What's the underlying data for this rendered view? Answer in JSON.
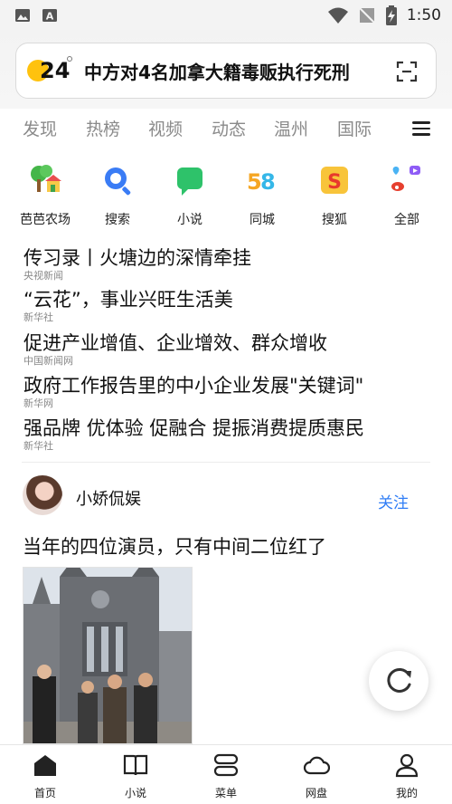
{
  "status_bar": {
    "time": "1:50"
  },
  "search": {
    "temperature": "24",
    "hot_query": "中方对4名加拿大籍毒贩执行死刑"
  },
  "tabs": [
    "发现",
    "热榜",
    "视频",
    "动态",
    "温州",
    "国际"
  ],
  "shortcuts": [
    {
      "label": "芭芭农场",
      "icon": "farm-icon"
    },
    {
      "label": "搜索",
      "icon": "search-icon"
    },
    {
      "label": "小说",
      "icon": "novel-icon"
    },
    {
      "label": "同城",
      "icon": "58-icon"
    },
    {
      "label": "搜狐",
      "icon": "sohu-icon"
    },
    {
      "label": "全部",
      "icon": "all-apps-icon"
    }
  ],
  "news": [
    {
      "title": "传习录丨火塘边的深情牵挂",
      "source": "央视新闻"
    },
    {
      "title": "“云花”，事业兴旺生活美",
      "source": "新华社"
    },
    {
      "title": "促进产业增值、企业增效、群众增收",
      "source": "中国新闻网"
    },
    {
      "title": "政府工作报告里的中小企业发展\"关键词\"",
      "source": "新华网"
    },
    {
      "title": "强品牌 优体验 促融合 提振消费提质惠民",
      "source": "新华社"
    }
  ],
  "feed_card": {
    "author": "小娇侃娱",
    "follow_label": "关注",
    "title": "当年的四位演员，只有中间二位红了"
  },
  "bottom_nav": [
    {
      "label": "首页",
      "icon": "home-icon"
    },
    {
      "label": "小说",
      "icon": "book-icon"
    },
    {
      "label": "菜单",
      "icon": "menu-icon"
    },
    {
      "label": "网盘",
      "icon": "cloud-icon"
    },
    {
      "label": "我的",
      "icon": "user-icon"
    }
  ],
  "colors": {
    "accent": "#2f7df6",
    "sun": "#ffc20e"
  }
}
